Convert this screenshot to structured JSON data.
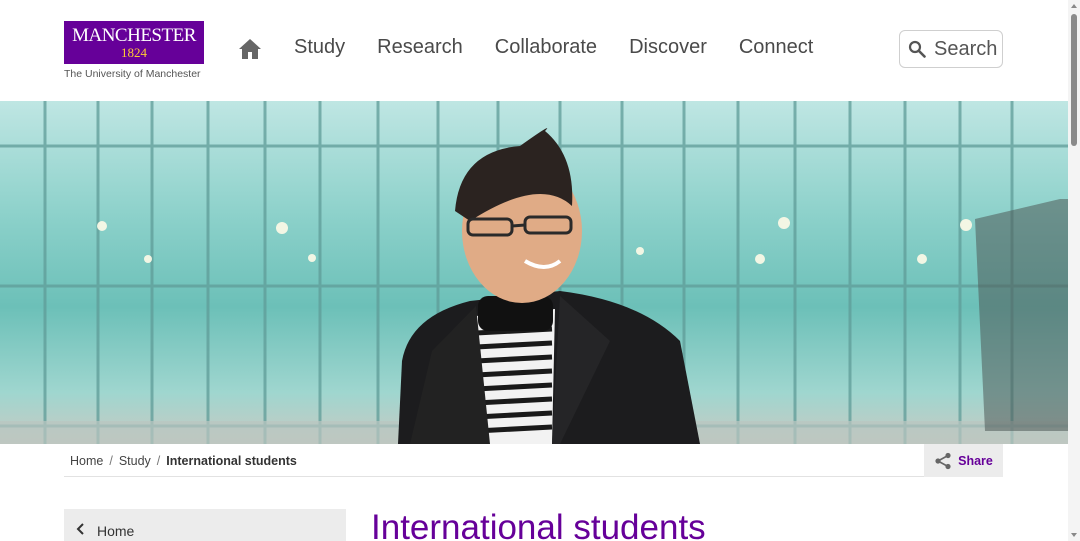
{
  "logo": {
    "name": "MANCHESTER",
    "year": "1824",
    "subtitle": "The University of Manchester"
  },
  "header": {
    "nav": [
      {
        "label": "Study"
      },
      {
        "label": "Research"
      },
      {
        "label": "Collaborate"
      },
      {
        "label": "Discover"
      },
      {
        "label": "Connect"
      }
    ],
    "search_label": "Search"
  },
  "breadcrumb": {
    "items": [
      "Home",
      "Study"
    ],
    "current": "International students",
    "separator": "/"
  },
  "share_label": "Share",
  "sidenav": {
    "back_label": "Home"
  },
  "page": {
    "title": "International students"
  },
  "colors": {
    "brand_purple": "#660099",
    "brand_gold": "#ffcc33"
  },
  "icons": [
    "home-icon",
    "search-icon",
    "share-icon",
    "chevron-left-icon"
  ]
}
